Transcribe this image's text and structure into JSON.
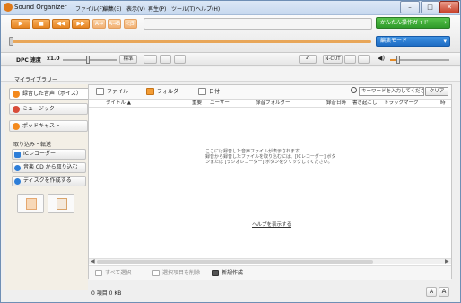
{
  "window": {
    "title": "Sound Organizer"
  },
  "menu": [
    "ファイル(F)",
    "編集(E)",
    "表示(V)",
    "再生(P)",
    "ツール(T)",
    "ヘルプ(H)"
  ],
  "window_buttons": {
    "minimize": "–",
    "maximize": "□",
    "close": "✕"
  },
  "transport": {
    "play": "▶",
    "stop": "■",
    "prev": "◀◀",
    "next": "▶▶",
    "a_marker": "A→",
    "ab_marker": "A→B",
    "skip_back": "◁5"
  },
  "guide_button": "かんたん操作ガイド",
  "mode_button": "編集モード",
  "control_bar": {
    "dpc_label": "DPC 速度",
    "dpc_value": "x1.0",
    "standard_button": "標準",
    "ncut_button": "N-CUT"
  },
  "library": {
    "title": "マイライブラリー"
  },
  "sidebar": {
    "items": [
      {
        "label": "録音した音声（ボイス）",
        "active": true
      },
      {
        "label": "ミュージック",
        "active": false
      },
      {
        "label": "ポッドキャスト",
        "active": false
      }
    ],
    "section_title": "取り込み・転送",
    "actions": [
      {
        "label": "ICレコーダー"
      },
      {
        "label": "音楽 CD から取り込む"
      },
      {
        "label": "ディスクを作成する"
      }
    ]
  },
  "view_tabs": [
    {
      "label": "ファイル",
      "selected": false
    },
    {
      "label": "フォルダー",
      "selected": true
    },
    {
      "label": "日付",
      "selected": false
    }
  ],
  "search": {
    "placeholder": "キーワードを入力してください",
    "clear_label": "クリア"
  },
  "columns": [
    "タイトル ▲",
    "重要",
    "ユーザー",
    "録音フォルダー",
    "録音日時",
    "書き起こし",
    "トラックマーク",
    "時"
  ],
  "empty_message": [
    "ここには録音した音声ファイルが表示されます。",
    "録音から録音したファイルを取り込むには、[ICレコーダー] ボタ",
    "ンまたは [ラジオレコーダー] ボタンをクリックしてください。"
  ],
  "help_link": "ヘルプを表示する",
  "bottom_actions": {
    "select_all": "すべて選択",
    "delete_selected": "選択項目を削除",
    "new_create": "新規作成"
  },
  "status": "0 項目  0 KB",
  "zoom": {
    "small": "A",
    "large": "A"
  }
}
